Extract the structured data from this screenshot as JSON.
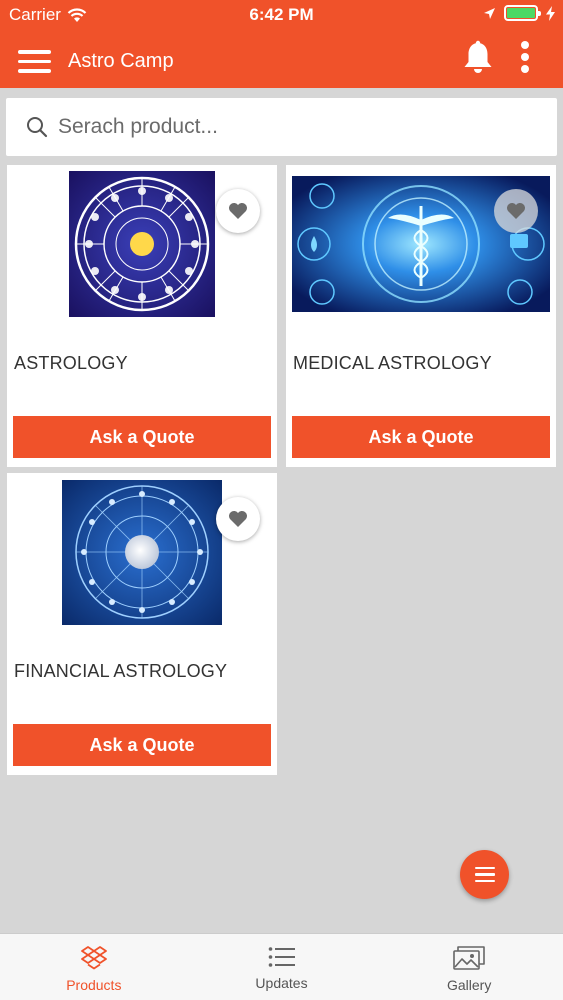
{
  "status_bar": {
    "carrier": "Carrier",
    "time": "6:42 PM",
    "battery_level": 1.0
  },
  "app_bar": {
    "title": "Astro Camp",
    "menu_icon": "hamburger-menu-icon",
    "notification_icon": "bell-icon",
    "more_icon": "vertical-dots-icon"
  },
  "search": {
    "placeholder": "Serach product...",
    "icon": "search-icon"
  },
  "products": [
    {
      "title": "ASTROLOGY",
      "action": "Ask a Quote",
      "image": "zodiac-wheel-image",
      "favorite_icon": "heart-icon"
    },
    {
      "title": "MEDICAL ASTROLOGY",
      "action": "Ask a Quote",
      "image": "caduceus-image",
      "favorite_icon": "heart-icon"
    },
    {
      "title": "FINANCIAL ASTROLOGY",
      "action": "Ask a Quote",
      "image": "moon-zodiac-image",
      "favorite_icon": "heart-icon"
    }
  ],
  "fab": {
    "icon": "list-menu-icon"
  },
  "tabs": [
    {
      "label": "Products",
      "icon": "dropbox-icon",
      "active": true
    },
    {
      "label": "Updates",
      "icon": "list-icon",
      "active": false
    },
    {
      "label": "Gallery",
      "icon": "image-gallery-icon",
      "active": false
    }
  ],
  "colors": {
    "accent": "#f0522a",
    "background": "#d6d6d6",
    "card": "#ffffff"
  }
}
